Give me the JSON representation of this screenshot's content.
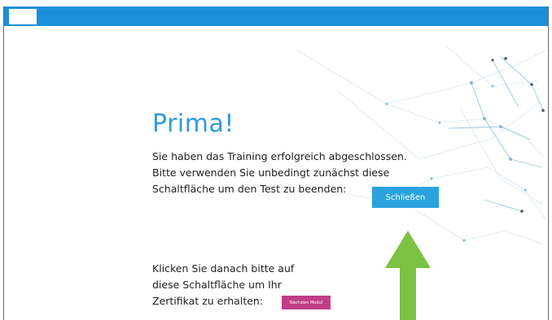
{
  "screen": {
    "headline": "Prima!",
    "paragraph_1": "Sie haben das Training erfolgreich abgeschlossen.\nBitte verwenden Sie unbedingt zunächst diese\nSchaltfläche um den Test zu beenden:",
    "paragraph_2": "Klicken Sie danach bitte auf\ndiese Schaltfläche um Ihr\nZertifikat zu erhalten:",
    "close_button_label": "Schließen",
    "next_module_button_label": "Nächsten Modul"
  },
  "style": {
    "accent": "#1c8fdb",
    "headline_color": "#2f9bd8",
    "close_button_color": "#2aa2de",
    "next_module_button_color": "#c13e87",
    "arrow_color": "#7dc243"
  },
  "icons": {
    "logo": "app-logo",
    "arrow": "green-up-arrow"
  }
}
